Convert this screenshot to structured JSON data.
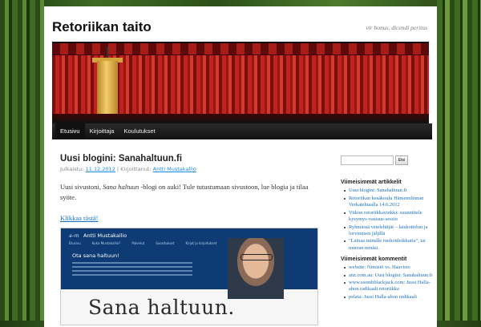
{
  "site": {
    "title": "Retoriikan taito",
    "description": "vir bonus, dicendi peritus"
  },
  "nav": {
    "items": [
      "Etusivu",
      "Kirjoittaja",
      "Koulutukset"
    ],
    "active_index": 0
  },
  "post": {
    "title": "Uusi blogini: Sanahaltuun.fi",
    "meta_prefix": "Julkaistu:",
    "date": "11.12.2012",
    "meta_sep": "| Kirjoittanut:",
    "author": "Antti Mustakallio",
    "body_prefix": "Uusi sivustoni, ",
    "body_emph": "Sana haltuun",
    "body_suffix": " -blogi on auki! Tule tutustumaan sivustoon, lue blogia ja tilaa syöte.",
    "link": "Klikkaa tästä!"
  },
  "screenshot": {
    "logo": "a–m",
    "name": "Antti Mustakallio",
    "nav": [
      "Etusivu",
      "Kuka Mustakallio?",
      "Palvelut",
      "Suositukset",
      "Kirjat ja kirjoitukset",
      "Ota yhteyttä"
    ],
    "tagline": "Ota sana haltuun!",
    "headline": "Sana haltuun."
  },
  "sidebar": {
    "search_placeholder": "",
    "search_button": "Etsi",
    "recent_posts_title": "Viimeisimmät artikkelit",
    "recent_posts": [
      "Uusi blogini: Sanahaltuun.fi",
      "Retoriikan kesäkoulu Hämeenlinnan Verkatehtaalla 14.6.2012",
      "Viikon retoriikkavinkki: suunnittele kysymys-vastaus-sessio",
      "Ryhmässä vetelehtijät – laiskottelun ja lorvimisen jäljillä",
      "\"Lainaa minulle ruohonleikkuria\", tai murran nenäsi."
    ],
    "recent_comments_title": "Viimeisimmät kommentit",
    "recent_comments": [
      "website: Nimistö vs. Haavisto",
      "anz.com.au: Uusi blogini: Sanahaltuun.fi",
      "www.ssombblackjack.com: Jussi Halla-ahon radikaali retoriikka",
      "pelata: Jussi Halla-ahon radikaali"
    ]
  }
}
